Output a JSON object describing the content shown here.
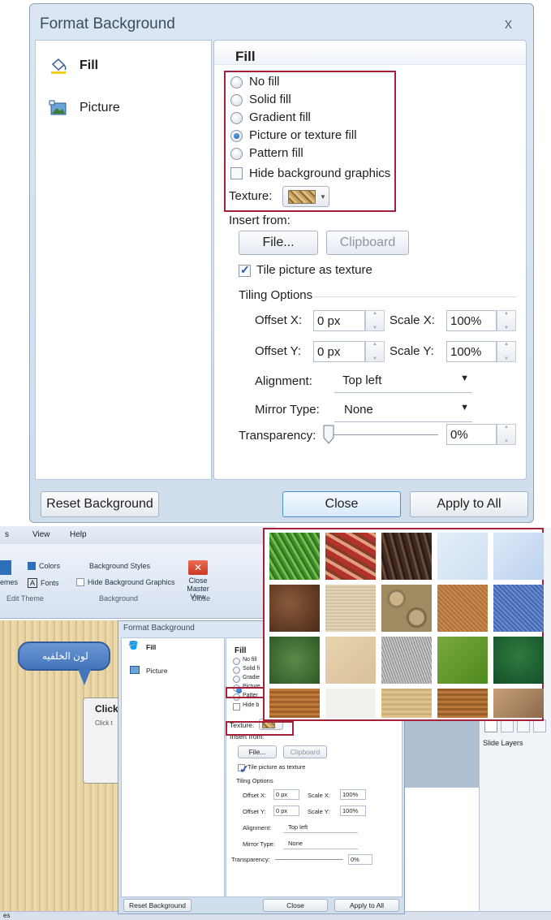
{
  "big_dialog": {
    "title": "Format Background",
    "close_glyph": "x",
    "nav": [
      {
        "label": "Fill",
        "icon": "paint-bucket-icon"
      },
      {
        "label": "Picture",
        "icon": "picture-icon"
      }
    ],
    "section_title": "Fill",
    "fill_options": [
      {
        "label": "No fill",
        "selected": false
      },
      {
        "label": "Solid fill",
        "selected": false
      },
      {
        "label": "Gradient fill",
        "selected": false
      },
      {
        "label": "Picture or texture fill",
        "selected": true
      },
      {
        "label": "Pattern fill",
        "selected": false
      }
    ],
    "hide_graphics": {
      "label": "Hide background graphics",
      "checked": false
    },
    "texture_label": "Texture:",
    "insert_from_label": "Insert from:",
    "file_button": "File...",
    "clipboard_button": "Clipboard",
    "tile_texture": {
      "label": "Tile picture as texture",
      "checked": true
    },
    "tiling_options_label": "Tiling Options",
    "offset_x_label": "Offset X:",
    "offset_x_value": "0 px",
    "scale_x_label": "Scale X:",
    "scale_x_value": "100%",
    "offset_y_label": "Offset Y:",
    "offset_y_value": "0 px",
    "scale_y_label": "Scale Y:",
    "scale_y_value": "100%",
    "alignment_label": "Alignment:",
    "alignment_value": "Top left",
    "mirror_label": "Mirror Type:",
    "mirror_value": "None",
    "transparency_label": "Transparency:",
    "transparency_value": "0%",
    "transparency_level": 0,
    "reset_button": "Reset Background",
    "close_button": "Close",
    "apply_all_button": "Apply to All"
  },
  "ribbon": {
    "menu": [
      "s",
      "View",
      "Help"
    ],
    "colors_label": "Colors",
    "fonts_label": "Fonts",
    "themes_label": "emes",
    "bg_styles_label": "Background Styles",
    "hide_bg_label": "Hide Background Graphics",
    "close_master_label": "Close Master View",
    "group_edit_theme": "Edit Theme",
    "group_background": "Background",
    "group_close": "Close"
  },
  "slide": {
    "callout_text": "لون الخلفيه",
    "click_title": "Click",
    "click_sub": "Click t"
  },
  "right_panel": {
    "slide_layers": "Slide Layers"
  },
  "status": {
    "left_text": "es"
  },
  "small_dialog": {
    "title": "Format Background",
    "nav_fill": "Fill",
    "nav_picture": "Picture",
    "section_title": "Fill",
    "options": [
      "No fill",
      "Solid fi",
      "Gradie",
      "Picture",
      "Patter",
      "Hide b"
    ],
    "texture_label": "Texture:",
    "insert_from_label": "Insert from:",
    "file_button": "File...",
    "clipboard_button": "Clipboard",
    "tile_label": "Tile picture as texture",
    "tiling_options_label": "Tiling Options",
    "offset_x_label": "Offset X:",
    "offset_x_value": "0 px",
    "scale_x_label": "Scale X:",
    "scale_x_value": "100%",
    "offset_y_label": "Offset Y:",
    "offset_y_value": "0 px",
    "scale_y_label": "Scale Y:",
    "scale_y_value": "100%",
    "alignment_label": "Alignment:",
    "alignment_value": "Top left",
    "mirror_label": "Mirror Type:",
    "mirror_value": "None",
    "transparency_label": "Transparency:",
    "transparency_value": "0%",
    "reset_button": "Reset Background",
    "close_button": "Close",
    "apply_all_button": "Apply to All"
  },
  "texture_gallery": {
    "tiles": [
      "green-grass",
      "autumn-leaves",
      "dark-bark",
      "pale-blue-paper",
      "blue-tissue",
      "brown-leather",
      "canvas",
      "river-pebbles",
      "cork",
      "blue-denim",
      "green-marble",
      "fossil",
      "granite",
      "green-paper",
      "dark-green-marble",
      "wood",
      "white-linen",
      "light-wood",
      "medium-wood",
      "crumpled-paper"
    ]
  },
  "colors": {
    "highlight_border": "#a5213a",
    "dialog_bg": "#d5e1ef",
    "accent_blue": "#1c5fb2"
  }
}
